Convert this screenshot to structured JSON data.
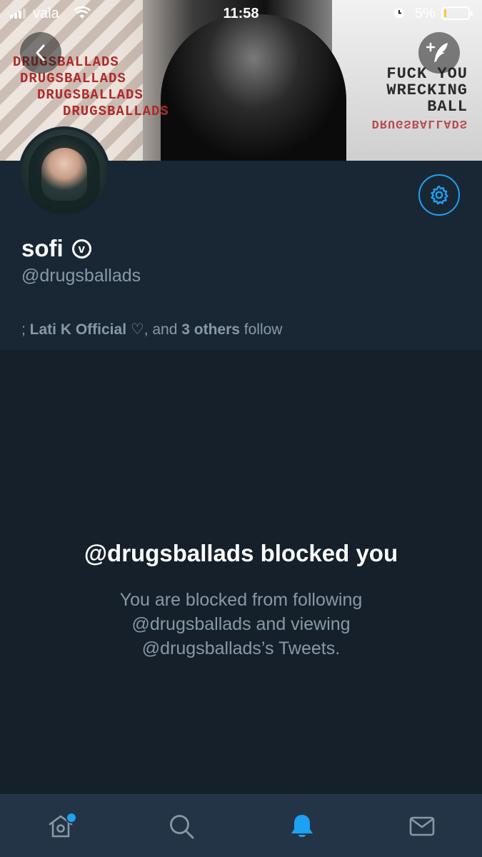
{
  "status_bar": {
    "carrier": "vala",
    "time": "11:58",
    "battery": "5%"
  },
  "banner": {
    "left_text": [
      "DRUGSBALLADS",
      "DRUGSBALLADS",
      "DRUGSBALLADS",
      "DRUGSBALLADS"
    ],
    "right_text": [
      "FUCK YOU",
      "WRECKING",
      "BALL",
      "DRUGSBALLADS"
    ]
  },
  "profile": {
    "display_name": "sofi",
    "verified_glyph": "v",
    "handle": "@drugsballads",
    "followers_prefix": "; ",
    "followers_name": "Lati K Official ♡",
    "followers_mid": ", and ",
    "followers_others": "3 others",
    "followers_suffix": " follow"
  },
  "blocked": {
    "title": "@drugsballads blocked you",
    "body": "You are blocked from following @drugsballads and viewing @drugsballads’s Tweets."
  },
  "tabs": [
    {
      "icon": "home-icon",
      "active": false,
      "badge": true
    },
    {
      "icon": "search-icon",
      "active": false
    },
    {
      "icon": "bell-icon",
      "active": true
    },
    {
      "icon": "mail-icon",
      "active": false
    }
  ],
  "colors": {
    "accent": "#1da1f2",
    "background": "#15202b",
    "header_bg": "#192734",
    "tabbar_bg": "#243447",
    "muted_text": "#8899a6"
  }
}
